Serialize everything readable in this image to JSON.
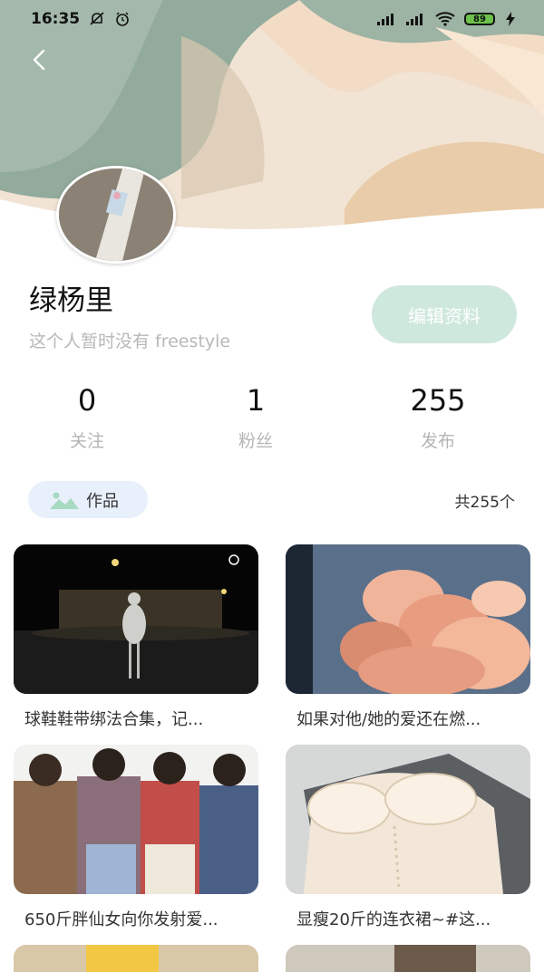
{
  "status_bar": {
    "time": "16:35",
    "battery": "89",
    "icons": [
      "mute-bell-icon",
      "alarm-icon",
      "signal-icon",
      "signal-icon",
      "wifi-icon",
      "battery-icon",
      "charging-icon"
    ]
  },
  "header": {
    "back_icon": "chevron-left-icon",
    "colors": {
      "sage": "#8fa89a",
      "peach": "#efd6bd",
      "cream": "#efe2d2"
    }
  },
  "profile": {
    "name": "绿杨里",
    "bio": "这个人暂时没有 freestyle",
    "edit_button": "编辑资料",
    "accent": "#cfe8dd"
  },
  "stats": [
    {
      "value": "0",
      "label": "关注"
    },
    {
      "value": "1",
      "label": "粉丝"
    },
    {
      "value": "255",
      "label": "发布"
    }
  ],
  "works": {
    "tab_label": "作品",
    "tab_icon": "image-icon",
    "total": "共255个"
  },
  "posts": [
    {
      "caption": "球鞋鞋带绑法合集，记..."
    },
    {
      "caption": "如果对他/她的爱还在燃..."
    },
    {
      "caption": "650斤胖仙女向你发射爱..."
    },
    {
      "caption": "显瘦20斤的连衣裙~#这..."
    }
  ]
}
